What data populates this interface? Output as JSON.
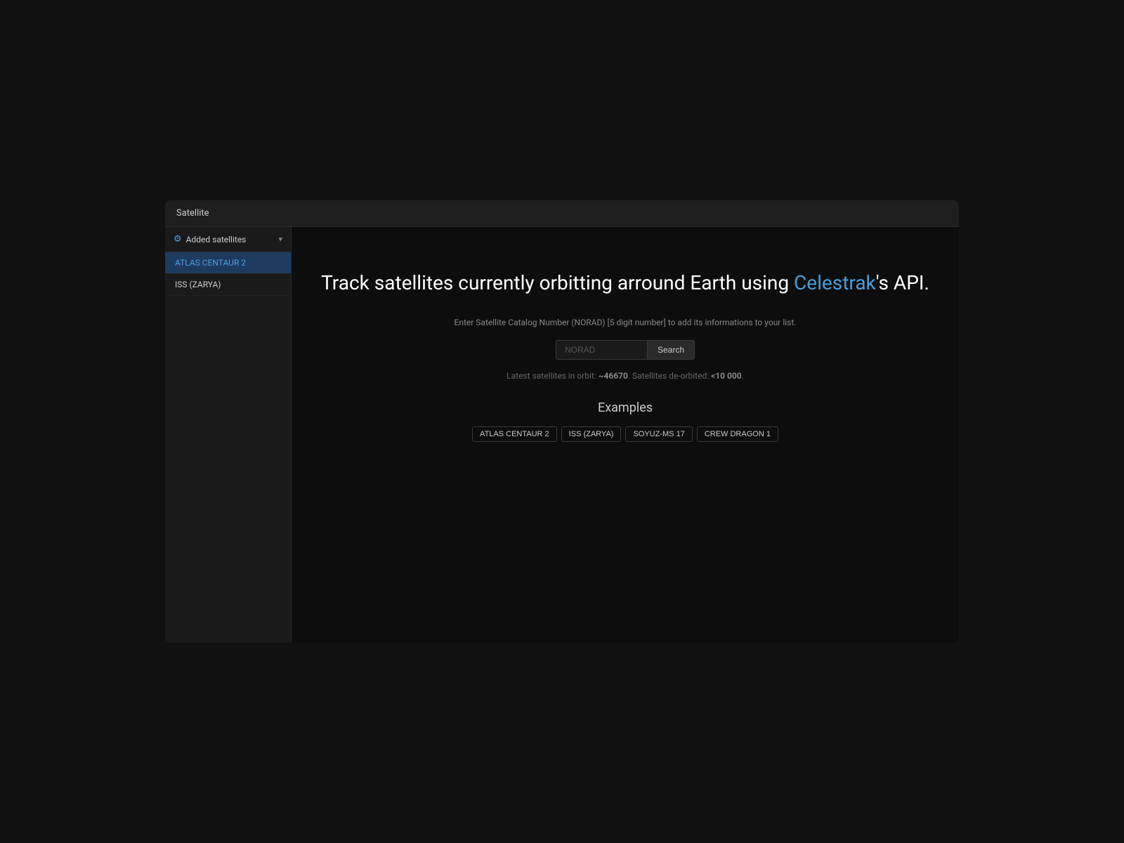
{
  "topbar": {
    "title": "Satellite"
  },
  "sidebar": {
    "section_label": "Added satellites",
    "chevron": "▾",
    "items": [
      {
        "id": "atlas-centaur-2",
        "label": "ATLAS CENTAUR 2",
        "active": true
      },
      {
        "id": "iss-zarya",
        "label": "ISS (ZARYA)",
        "active": false
      }
    ]
  },
  "hero": {
    "title_start": "Track satellites currently orbitting arround Earth using ",
    "title_accent": "Celestrak",
    "title_end": "'s API.",
    "subtitle": "Enter Satellite Catalog Number (NORAD) [5 digit number] to add its informations to your list.",
    "input_placeholder": "NORAD",
    "search_button_label": "Search",
    "stats": {
      "text_start": "Latest satellites in orbit: ",
      "orbit_count": "~46670",
      "text_mid": ". Satellites de-orbited: ",
      "deorbit_count": "<10 000",
      "text_end": "."
    }
  },
  "examples": {
    "title": "Examples",
    "items": [
      {
        "id": "atlas-centaur-2",
        "label": "ATLAS CENTAUR 2"
      },
      {
        "id": "iss-zarya",
        "label": "ISS (ZARYA)"
      },
      {
        "id": "soyuz-ms-17",
        "label": "SOYUZ-MS 17"
      },
      {
        "id": "crew-dragon-1",
        "label": "CREW DRAGON 1"
      }
    ]
  },
  "colors": {
    "accent": "#4a9edd",
    "sidebar_active_bg": "#1e3a5f",
    "sidebar_active_text": "#4a9edd"
  }
}
